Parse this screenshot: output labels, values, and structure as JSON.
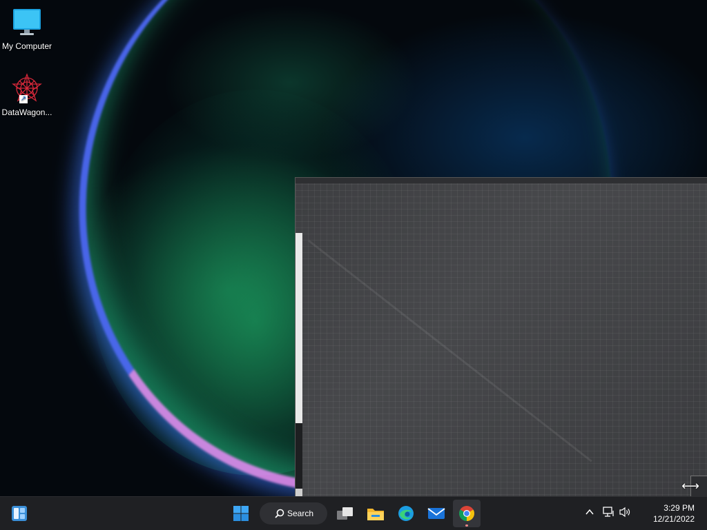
{
  "desktop": {
    "icons": [
      {
        "label": "My Computer",
        "icon": "monitor-icon"
      },
      {
        "label": "DataWagon...",
        "icon": "datawagon-app-icon"
      }
    ]
  },
  "taskbar": {
    "search_label": "Search",
    "apps": [
      {
        "name": "widgets",
        "icon": "widgets-icon"
      },
      {
        "name": "start",
        "icon": "windows-start-icon"
      },
      {
        "name": "task-view",
        "icon": "task-view-icon"
      },
      {
        "name": "file-explorer",
        "icon": "folder-icon"
      },
      {
        "name": "edge",
        "icon": "edge-browser-icon"
      },
      {
        "name": "mail",
        "icon": "mail-icon"
      },
      {
        "name": "chrome",
        "icon": "chrome-browser-icon",
        "active": true
      }
    ]
  },
  "tray": {
    "time": "3:29 PM",
    "date": "12/21/2022",
    "icons": [
      "chevron-up-icon",
      "network-icon",
      "volume-icon"
    ]
  },
  "colors": {
    "taskbar_bg": "#1f2023",
    "window_bg": "#3b3c3f",
    "accent_blue": "#1e90ff"
  }
}
